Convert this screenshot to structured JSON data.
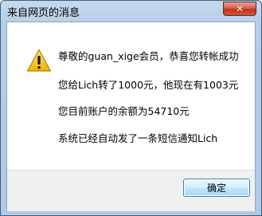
{
  "window": {
    "title": "来自网页的消息",
    "close_icon": "close-icon"
  },
  "message": {
    "icon": "warning-icon",
    "lines": [
      "尊敬的guan_xige会员，恭喜您转帐成功",
      "您给Lich转了1000元，他现在有1003元",
      "您目前账户的余额为54710元",
      "系统已经自动发了一条短信通知Lich"
    ]
  },
  "buttons": {
    "ok_label": "确定"
  },
  "colors": {
    "frame": "#b7cde6",
    "close_button": "#c1301a",
    "content_bg": "#ffffff",
    "footer_bg": "#f0f0f0",
    "warning_yellow": "#f5c400"
  }
}
